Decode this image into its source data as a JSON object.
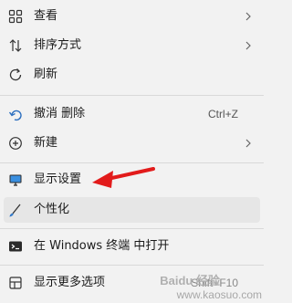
{
  "menu": {
    "items": [
      {
        "label": "查看",
        "icon": "view-icon"
      },
      {
        "label": "排序方式",
        "icon": "sort-icon"
      },
      {
        "label": "刷新",
        "icon": "refresh-icon"
      },
      {
        "label": "撤消 删除",
        "icon": "undo-icon",
        "shortcut": "Ctrl+Z"
      },
      {
        "label": "新建",
        "icon": "new-icon"
      },
      {
        "label": "显示设置",
        "icon": "display-settings-icon"
      },
      {
        "label": "个性化",
        "icon": "personalize-icon"
      },
      {
        "label": "在 Windows 终端 中打开",
        "icon": "terminal-icon"
      },
      {
        "label": "显示更多选项",
        "icon": "more-options-icon",
        "shortcut": "Shift+F10"
      }
    ]
  },
  "annotation": {
    "color": "#e21b1b",
    "type": "red-arrow"
  },
  "watermark": {
    "logo": "Baidu 经验",
    "text": "www.kaosuo.com"
  }
}
